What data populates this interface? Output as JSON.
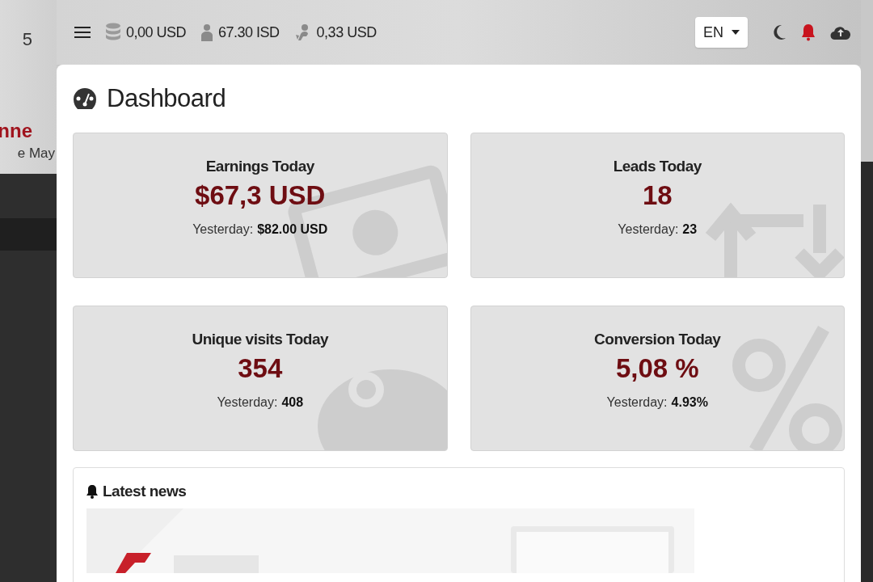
{
  "sidebar": {
    "counter": "5",
    "user_name": "nne",
    "user_subtitle": "e May"
  },
  "topbar": {
    "balances": [
      {
        "kind": "coins",
        "value": "0,00 USD"
      },
      {
        "kind": "user",
        "value": "67.30 ISD"
      },
      {
        "kind": "referral",
        "value": "0,33 USD"
      }
    ],
    "language": "EN",
    "notifications_unread": true
  },
  "page": {
    "title": "Dashboard"
  },
  "stats": [
    {
      "kind": "money",
      "title": "Earnings Today",
      "value": "$67,3 USD",
      "yesterday_label": "Yesterday:",
      "yesterday_value": "$82.00 USD"
    },
    {
      "kind": "leads",
      "title": "Leads Today",
      "value": "18",
      "yesterday_label": "Yesterday:",
      "yesterday_value": "23"
    },
    {
      "kind": "visits",
      "title": "Unique visits Today",
      "value": "354",
      "yesterday_label": "Yesterday:",
      "yesterday_value": "408"
    },
    {
      "kind": "conversion",
      "title": "Conversion Today",
      "value": "5,08 %",
      "yesterday_label": "Yesterday:",
      "yesterday_value": "4.93%"
    }
  ],
  "news": {
    "title": "Latest news"
  }
}
